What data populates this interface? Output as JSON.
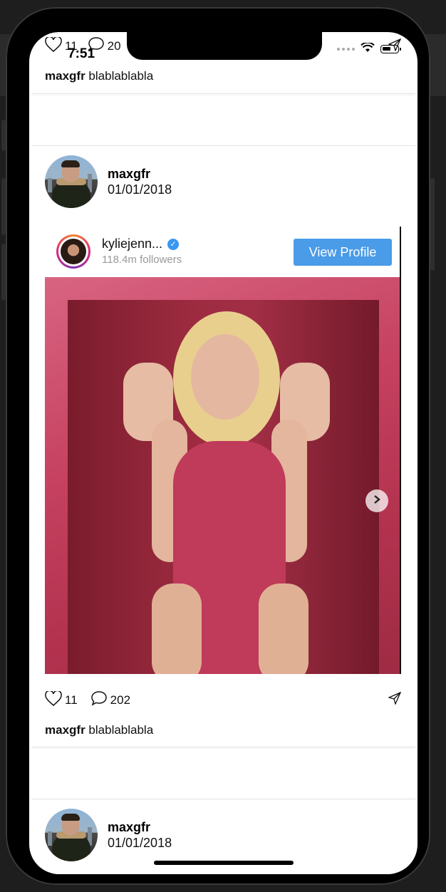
{
  "status_bar": {
    "time": "7:51"
  },
  "top_post": {
    "likes": "11",
    "comments": "20",
    "caption_user": "maxgfr",
    "caption_text": "blablablabla"
  },
  "post": {
    "username": "maxgfr",
    "date": "01/01/2018",
    "embed": {
      "account_name": "kyliejenn...",
      "followers": "118.4m followers",
      "view_profile_label": "View Profile"
    },
    "likes": "11",
    "comments": "202",
    "caption_user": "maxgfr",
    "caption_text": "blablablabla"
  },
  "next_post": {
    "username": "maxgfr",
    "date": "01/01/2018"
  },
  "colors": {
    "accent": "#4a9be8",
    "verified": "#3897f0",
    "photo_pink": "#c5415f"
  },
  "icons": [
    "heart-icon",
    "comment-icon",
    "send-icon",
    "verified-badge-icon",
    "chevron-right-icon"
  ]
}
